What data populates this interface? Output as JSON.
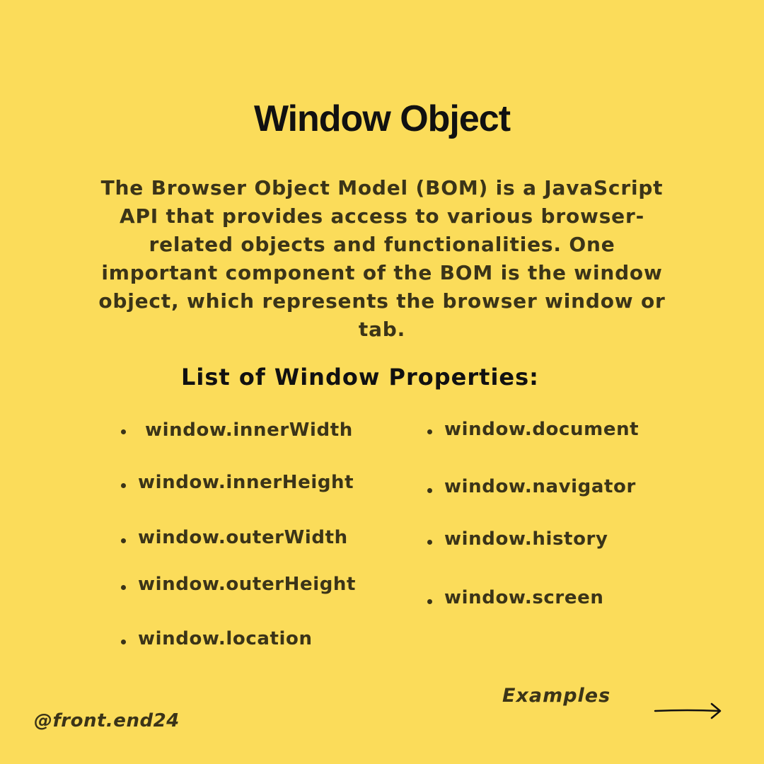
{
  "title": "Window Object",
  "intro": "The Browser Object Model (BOM) is a JavaScript API that provides access to various browser-related objects and functionalities. One important component of the BOM is the window object, which represents the browser window or tab.",
  "list_heading": "List of Window Properties:",
  "properties_left": [
    "window.innerWidth",
    "window.innerHeight",
    "window.outerWidth",
    "window.outerHeight",
    "window.location"
  ],
  "properties_right": [
    "window.document",
    "window.navigator",
    "window.history",
    "window.screen"
  ],
  "examples_label": "Examples",
  "handle": "@front.end24",
  "icons": {
    "next": "arrow-right-icon",
    "bullet": "bullet-icon"
  },
  "colors": {
    "background": "#fbdc5a",
    "text": "#3b3418",
    "heading": "#111111"
  }
}
